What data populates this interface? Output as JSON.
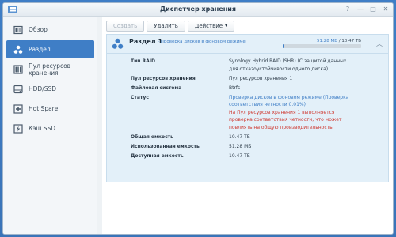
{
  "window": {
    "title": "Диспетчер хранения",
    "controls": [
      {
        "name": "help-icon",
        "glyph": "?"
      },
      {
        "name": "minimize-icon",
        "glyph": "—"
      },
      {
        "name": "maximize-icon",
        "glyph": "□"
      },
      {
        "name": "close-icon",
        "glyph": "✕"
      }
    ]
  },
  "sidebar": {
    "items": [
      {
        "label": "Обзор",
        "icon": "overview-icon",
        "active": false
      },
      {
        "label": "Раздел",
        "icon": "volume-icon",
        "active": true
      },
      {
        "label": "Пул ресурсов хранения",
        "icon": "storage-pool-icon",
        "active": false
      },
      {
        "label": "HDD/SSD",
        "icon": "hdd-icon",
        "active": false
      },
      {
        "label": "Hot Spare",
        "icon": "hot-spare-icon",
        "active": false
      },
      {
        "label": "Кэш SSD",
        "icon": "ssd-cache-icon",
        "active": false
      }
    ]
  },
  "toolbar": {
    "create_label": "Создать",
    "delete_label": "Удалить",
    "action_label": "Действие"
  },
  "volume": {
    "title": "Раздел 1",
    "status_short": "- Проверка дисков в фоновом режиме",
    "used": "51.28 МБ",
    "total": "/ 10.47 ТБ",
    "usage_fraction": 0.005
  },
  "details": {
    "raid_type_label": "Тип RAID",
    "raid_type_value": "Synology Hybrid RAID (SHR) (С защитой данных",
    "raid_type_value2": "для отказоустойчивости одного диска)",
    "pool_label": "Пул ресурсов хранения",
    "pool_value": "Пул ресурсов хранения 1",
    "fs_label": "Файловая система",
    "fs_value": "Btrfs",
    "status_label": "Статус",
    "status_value1": "Проверка дисков в фоновом режиме (Проверка",
    "status_value2": "соответствия четности 0.01%)",
    "warning1": "На Пул ресурсов хранения 1 выполняется",
    "warning2": "проверка соответствия четности, что может",
    "warning3": "повлиять на общую производительность.",
    "total_label": "Общая емкость",
    "total_value": "10.47 ТБ",
    "used_label": "Использованная емкость",
    "used_value": "51.28 МБ",
    "avail_label": "Доступная емкость",
    "avail_value": "10.47 ТБ"
  },
  "colors": {
    "accent": "#3f7ec6",
    "warning": "#cf3a32",
    "panel_bg": "#e3f0f9"
  }
}
